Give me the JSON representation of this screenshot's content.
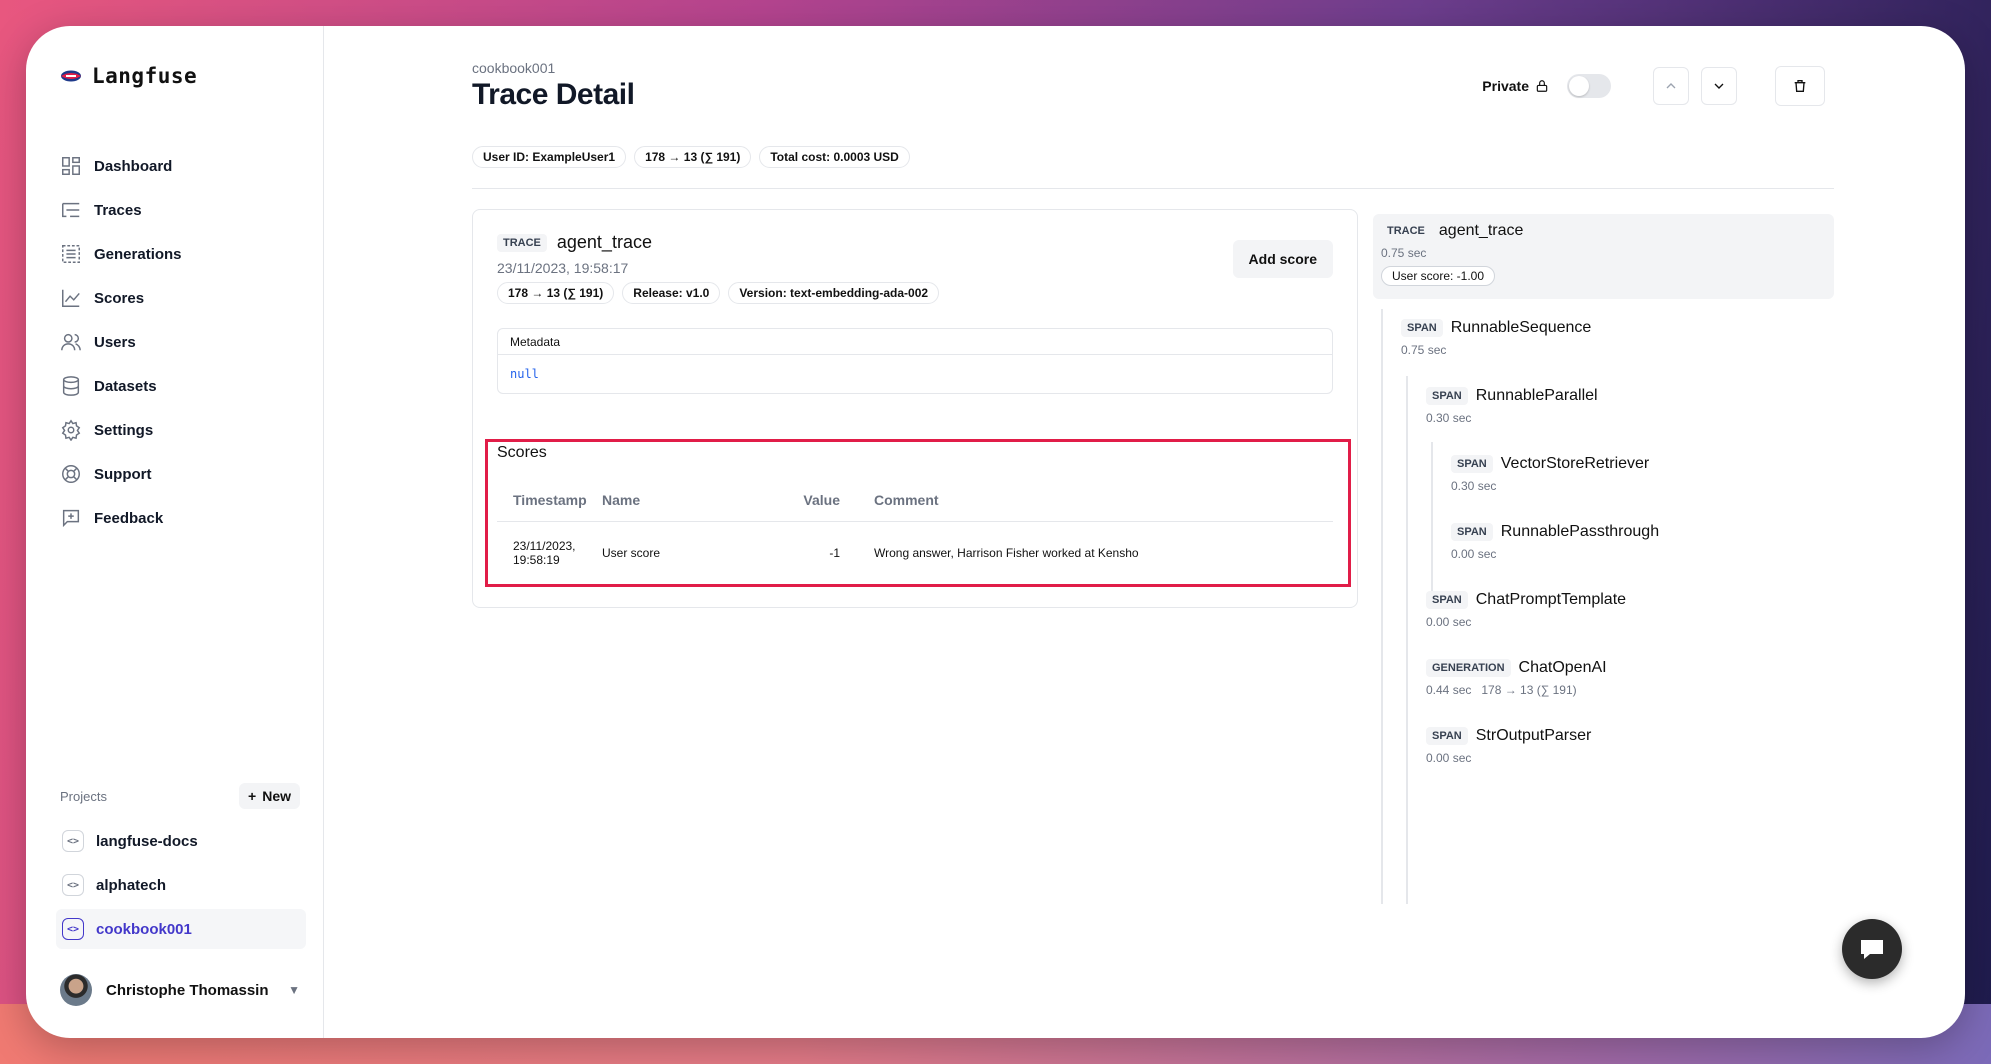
{
  "app": {
    "name": "Langfuse"
  },
  "sidebar": {
    "items": [
      {
        "label": "Dashboard",
        "icon": "dashboard-icon"
      },
      {
        "label": "Traces",
        "icon": "traces-icon"
      },
      {
        "label": "Generations",
        "icon": "generations-icon"
      },
      {
        "label": "Scores",
        "icon": "scores-icon"
      },
      {
        "label": "Users",
        "icon": "users-icon"
      },
      {
        "label": "Datasets",
        "icon": "datasets-icon"
      },
      {
        "label": "Settings",
        "icon": "settings-icon"
      },
      {
        "label": "Support",
        "icon": "support-icon"
      },
      {
        "label": "Feedback",
        "icon": "feedback-icon"
      }
    ],
    "projects_label": "Projects",
    "new_label": "New",
    "projects": [
      {
        "label": "langfuse-docs",
        "active": false
      },
      {
        "label": "alphatech",
        "active": false
      },
      {
        "label": "cookbook001",
        "active": true
      }
    ],
    "user_name": "Christophe Thomassin"
  },
  "header": {
    "breadcrumb": "cookbook001",
    "title": "Trace Detail",
    "private_label": "Private",
    "badges": [
      "User ID: ExampleUser1",
      "178 → 13 (∑ 191)",
      "Total cost: 0.0003 USD"
    ]
  },
  "trace": {
    "tag": "TRACE",
    "name": "agent_trace",
    "timestamp": "23/11/2023, 19:58:17",
    "badges": [
      "178 → 13 (∑ 191)",
      "Release: v1.0",
      "Version: text-embedding-ada-002"
    ],
    "add_score_label": "Add score",
    "metadata_title": "Metadata",
    "metadata_value": "null",
    "scores_title": "Scores",
    "scores_columns": [
      "Timestamp",
      "Name",
      "Value",
      "Comment"
    ],
    "scores_rows": [
      {
        "timestamp_line1": "23/11/2023,",
        "timestamp_line2": "19:58:19",
        "name": "User score",
        "value": "-1",
        "comment": "Wrong answer, Harrison Fisher worked at Kensho"
      }
    ]
  },
  "tree": {
    "root": {
      "tag": "TRACE",
      "name": "agent_trace",
      "sub": "0.75 sec",
      "score": "User score: -1.00"
    },
    "nodes": [
      {
        "tag": "SPAN",
        "name": "RunnableSequence",
        "sub": "0.75 sec"
      },
      {
        "tag": "SPAN",
        "name": "RunnableParallel",
        "sub": "0.30 sec"
      },
      {
        "tag": "SPAN",
        "name": "VectorStoreRetriever",
        "sub": "0.30 sec"
      },
      {
        "tag": "SPAN",
        "name": "RunnablePassthrough",
        "sub": "0.00 sec"
      },
      {
        "tag": "SPAN",
        "name": "ChatPromptTemplate",
        "sub": "0.00 sec"
      },
      {
        "tag": "GENERATION",
        "name": "ChatOpenAI",
        "sub": "0.44 sec   178 → 13 (∑ 191)"
      },
      {
        "tag": "SPAN",
        "name": "StrOutputParser",
        "sub": "0.00 sec"
      }
    ]
  },
  "colors": {
    "accent": "#4338ca",
    "highlight_border": "#e11d48"
  }
}
